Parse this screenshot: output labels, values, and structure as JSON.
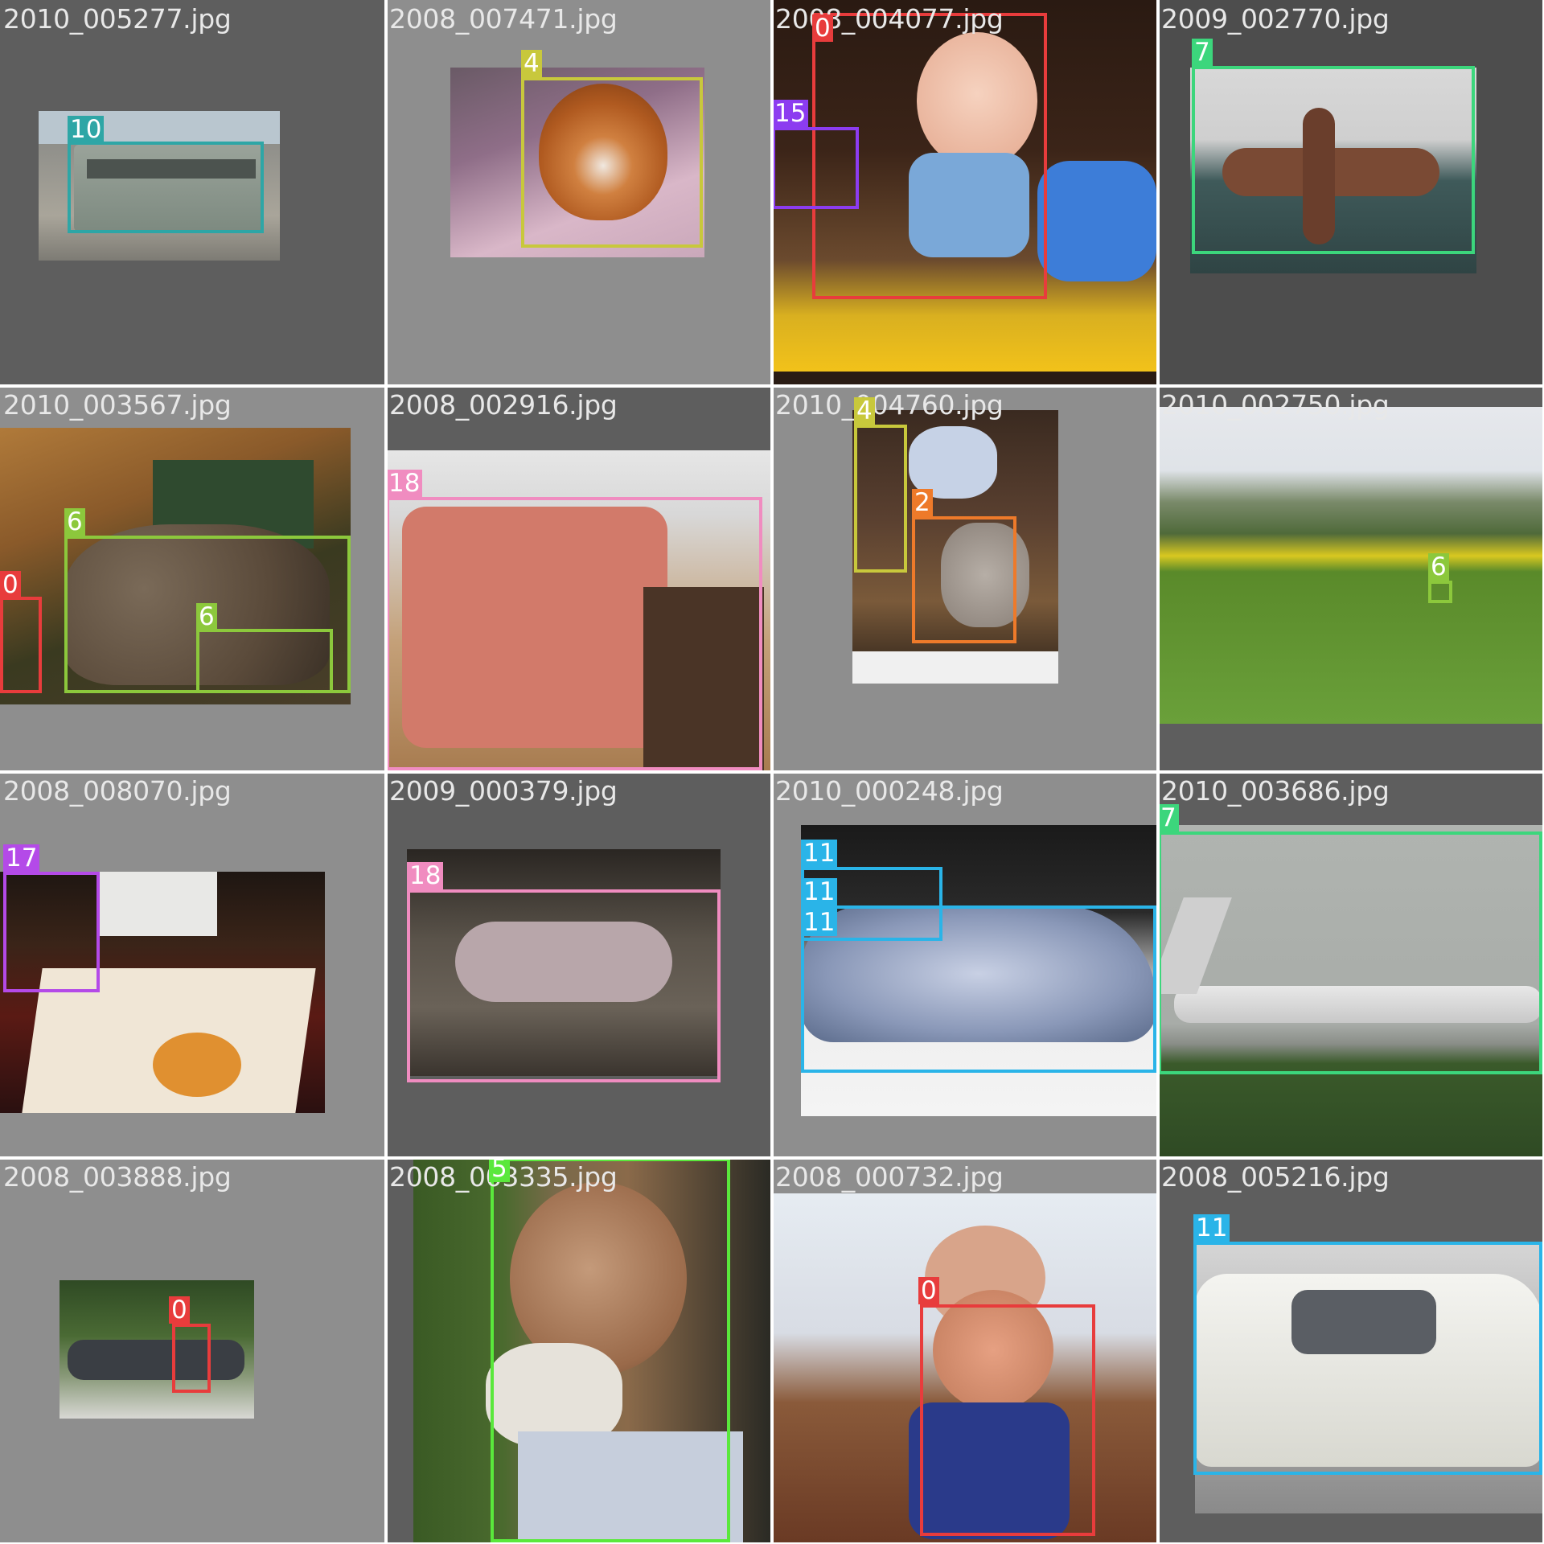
{
  "mosaic": {
    "tiles": [
      {
        "filename": "2010_005277.jpg",
        "photo_subject": "bus",
        "boxes": [
          {
            "label": "10",
            "color": "#2ea6a6"
          }
        ]
      },
      {
        "filename": "2008_007471.jpg",
        "photo_subject": "dog",
        "boxes": [
          {
            "label": "4",
            "color": "#c8c83c"
          }
        ]
      },
      {
        "filename": "2008_004077.jpg",
        "photo_subject": "baby",
        "boxes": [
          {
            "label": "0",
            "color": "#e83c3c"
          },
          {
            "label": "15",
            "color": "#8c3cf0"
          }
        ]
      },
      {
        "filename": "2009_002770.jpg",
        "photo_subject": "airplane",
        "boxes": [
          {
            "label": "7",
            "color": "#3cd67c"
          }
        ]
      },
      {
        "filename": "2010_003567.jpg",
        "photo_subject": "sheep",
        "boxes": [
          {
            "label": "6",
            "color": "#8cc83c"
          },
          {
            "label": "6",
            "color": "#8cc83c"
          },
          {
            "label": "0",
            "color": "#e83c3c"
          }
        ]
      },
      {
        "filename": "2008_002916.jpg",
        "photo_subject": "sofa",
        "boxes": [
          {
            "label": "18",
            "color": "#f08cc0"
          }
        ]
      },
      {
        "filename": "2010_004760.jpg",
        "photo_subject": "cat",
        "boxes": [
          {
            "label": "4",
            "color": "#c8c83c"
          },
          {
            "label": "2",
            "color": "#ee7a2a"
          }
        ]
      },
      {
        "filename": "2010_002750.jpg",
        "photo_subject": "field",
        "boxes": [
          {
            "label": "6",
            "color": "#8cc83c"
          }
        ]
      },
      {
        "filename": "2008_008070.jpg",
        "photo_subject": "dining",
        "boxes": [
          {
            "label": "17",
            "color": "#b44ae8"
          }
        ]
      },
      {
        "filename": "2009_000379.jpg",
        "photo_subject": "sleep",
        "boxes": [
          {
            "label": "18",
            "color": "#f08cc0"
          }
        ]
      },
      {
        "filename": "2010_000248.jpg",
        "photo_subject": "car",
        "boxes": [
          {
            "label": "11",
            "color": "#2ab4e8"
          },
          {
            "label": "11",
            "color": "#2ab4e8"
          },
          {
            "label": "11",
            "color": "#2ab4e8"
          }
        ]
      },
      {
        "filename": "2010_003686.jpg",
        "photo_subject": "jet",
        "boxes": [
          {
            "label": "7",
            "color": "#3cd67c"
          }
        ]
      },
      {
        "filename": "2008_003888.jpg",
        "photo_subject": "street",
        "boxes": [
          {
            "label": "0",
            "color": "#e83c3c"
          }
        ]
      },
      {
        "filename": "2008_003335.jpg",
        "photo_subject": "oldman",
        "boxes": [
          {
            "label": "5",
            "color": "#5ae83c"
          }
        ]
      },
      {
        "filename": "2008_000732.jpg",
        "photo_subject": "mombaby",
        "boxes": [
          {
            "label": "0",
            "color": "#e83c3c"
          }
        ]
      },
      {
        "filename": "2008_005216.jpg",
        "photo_subject": "taxi",
        "boxes": [
          {
            "label": "11",
            "color": "#2ab4e8"
          }
        ]
      }
    ]
  }
}
